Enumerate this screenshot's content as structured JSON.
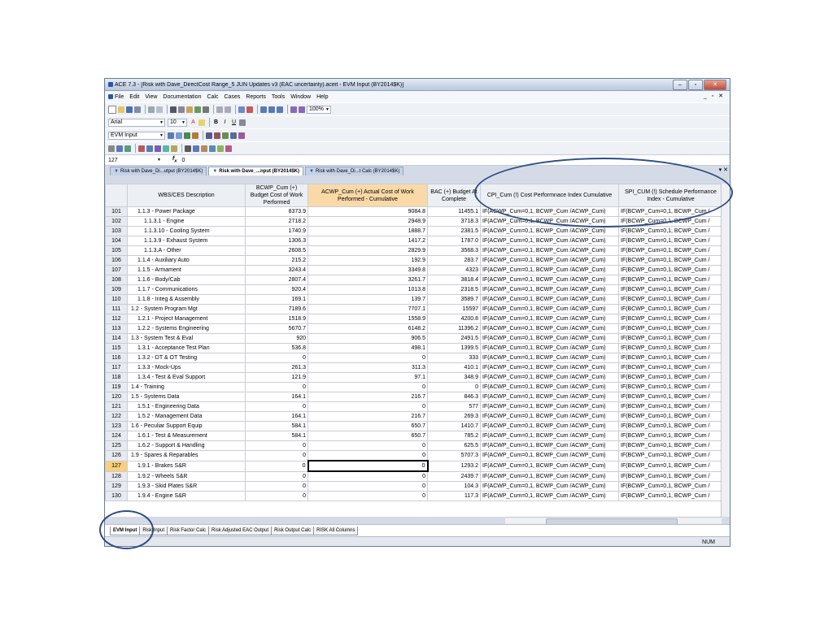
{
  "window": {
    "title": "ACE 7.3 - [Risk with Dave_DirectCost Range_5 JUN Updates v3 (EAC uncertainty).aceit - EVM Input (BY2014$K)]"
  },
  "menu": [
    "File",
    "Edit",
    "View",
    "Documentation",
    "Calc",
    "Cases",
    "Reports",
    "Tools",
    "Window",
    "Help"
  ],
  "toolbar": {
    "zoom": "100%"
  },
  "font": {
    "name": "Arial",
    "size": "10"
  },
  "view_combo": "EVM Input",
  "formula": {
    "cell": "127",
    "value": "0"
  },
  "doc_tabs": [
    "Risk with Dave_Di...utput (BY2014$K)",
    "Risk with Dave_...nput (BY2014$K)",
    "Risk with Dave_Di...t Calc (BY2014$K)"
  ],
  "columns": [
    "WBS/CES Description",
    "BCWP_Cum (+) Budget Cost of Work Performed",
    "ACWP_Cum (+) Actual Cost of Work Performed - Cumulative",
    "BAC (+) Budget At Complete",
    "CPI_Cum (!) Cost Performnace Index Cumulative",
    "SPI_CUM (!) Schedule Performance Index - Cumulative"
  ],
  "rows": [
    {
      "n": "101",
      "d": "1.1.3 - Power Package",
      "i": 1,
      "bcwp": "8373.9",
      "acwp": "9084.8",
      "bac": "11455.1"
    },
    {
      "n": "102",
      "d": "1.1.3.1 - Engine",
      "i": 2,
      "bcwp": "2718.2",
      "acwp": "2948.9",
      "bac": "3718.3"
    },
    {
      "n": "103",
      "d": "1.1.3.10 - Cooling System",
      "i": 2,
      "bcwp": "1740.9",
      "acwp": "1888.7",
      "bac": "2381.5"
    },
    {
      "n": "104",
      "d": "1.1.3.9 - Exhaust System",
      "i": 2,
      "bcwp": "1306.3",
      "acwp": "1417.2",
      "bac": "1787.0"
    },
    {
      "n": "105",
      "d": "1.1.3.A - Other",
      "i": 2,
      "bcwp": "2608.5",
      "acwp": "2829.9",
      "bac": "3568.3"
    },
    {
      "n": "106",
      "d": "1.1.4 - Auxiliary Auto",
      "i": 1,
      "bcwp": "215.2",
      "acwp": "192.9",
      "bac": "283.7"
    },
    {
      "n": "107",
      "d": "1.1.5 - Armament",
      "i": 1,
      "bcwp": "3243.4",
      "acwp": "3349.8",
      "bac": "4323"
    },
    {
      "n": "108",
      "d": "1.1.6 - Body/Cab",
      "i": 1,
      "bcwp": "2807.4",
      "acwp": "3261.7",
      "bac": "3818.4"
    },
    {
      "n": "109",
      "d": "1.1.7 - Communications",
      "i": 1,
      "bcwp": "920.4",
      "acwp": "1013.8",
      "bac": "2318.5"
    },
    {
      "n": "110",
      "d": "1.1.8 - Integ & Assembly",
      "i": 1,
      "bcwp": "169.1",
      "acwp": "139.7",
      "bac": "3589.7"
    },
    {
      "n": "111",
      "d": "1.2 - System Program Mgt",
      "i": 0,
      "bcwp": "7189.6",
      "acwp": "7707.1",
      "bac": "15597"
    },
    {
      "n": "112",
      "d": "1.2.1 - Project Management",
      "i": 1,
      "bcwp": "1518.9",
      "acwp": "1558.9",
      "bac": "4200.8"
    },
    {
      "n": "113",
      "d": "1.2.2 - Systems Engineering",
      "i": 1,
      "bcwp": "5670.7",
      "acwp": "6148.2",
      "bac": "11396.2"
    },
    {
      "n": "114",
      "d": "1.3 - System Test & Eval",
      "i": 0,
      "bcwp": "920",
      "acwp": "906.5",
      "bac": "2491.5"
    },
    {
      "n": "115",
      "d": "1.3.1 - Acceptance Test Plan",
      "i": 1,
      "bcwp": "536.8",
      "acwp": "498.1",
      "bac": "1399.5"
    },
    {
      "n": "116",
      "d": "1.3.2 - DT & OT Testing",
      "i": 1,
      "bcwp": "0",
      "acwp": "0",
      "bac": "333"
    },
    {
      "n": "117",
      "d": "1.3.3 - Mock-Ups",
      "i": 1,
      "bcwp": "261.3",
      "acwp": "311.3",
      "bac": "410.1"
    },
    {
      "n": "118",
      "d": "1.3.4 - Test & Eval Support",
      "i": 1,
      "bcwp": "121.9",
      "acwp": "97.1",
      "bac": "348.9"
    },
    {
      "n": "119",
      "d": "1.4 - Training",
      "i": 0,
      "bcwp": "0",
      "acwp": "0",
      "bac": "0"
    },
    {
      "n": "120",
      "d": "1.5 - Systems Data",
      "i": 0,
      "bcwp": "164.1",
      "acwp": "216.7",
      "bac": "846.3"
    },
    {
      "n": "121",
      "d": "1.5.1 - Engineering Data",
      "i": 1,
      "bcwp": "0",
      "acwp": "0",
      "bac": "577"
    },
    {
      "n": "122",
      "d": "1.5.2 - Management Data",
      "i": 1,
      "bcwp": "164.1",
      "acwp": "216.7",
      "bac": "269.3"
    },
    {
      "n": "123",
      "d": "1.6 - Peculiar Support Equip",
      "i": 0,
      "bcwp": "584.1",
      "acwp": "650.7",
      "bac": "1410.7"
    },
    {
      "n": "124",
      "d": "1.6.1 - Test & Measurement",
      "i": 1,
      "bcwp": "584.1",
      "acwp": "650.7",
      "bac": "785.2"
    },
    {
      "n": "125",
      "d": "1.6.2 - Support & Handling",
      "i": 1,
      "bcwp": "0",
      "acwp": "0",
      "bac": "625.5"
    },
    {
      "n": "126",
      "d": "1.9 - Spares & Reparables",
      "i": 0,
      "bcwp": "0",
      "acwp": "0",
      "bac": "5707.3"
    },
    {
      "n": "127",
      "d": "1.9.1 - Brakes S&R",
      "i": 1,
      "bcwp": "0",
      "acwp": "0",
      "bac": "1293.2"
    },
    {
      "n": "128",
      "d": "1.9.2 - Wheels S&R",
      "i": 1,
      "bcwp": "0",
      "acwp": "0",
      "bac": "2439.7"
    },
    {
      "n": "129",
      "d": "1.9.3 - Skid Plates S&R",
      "i": 1,
      "bcwp": "0",
      "acwp": "0",
      "bac": "104.3"
    },
    {
      "n": "130",
      "d": "1.9.4 - Engine S&R",
      "i": 1,
      "bcwp": "0",
      "acwp": "0",
      "bac": "117.3"
    }
  ],
  "cpi_formula": "IF(ACWP_Cum=0,1, BCWP_Cum /ACWP_Cum)",
  "spi_formula": "IF(BCWP_Cum=0,1, BCWP_Cum /",
  "selected_row": "127",
  "sheet_tabs": [
    "EVM Input",
    "Risk Input",
    "Risk Factor Calc",
    "Risk Adjusted EAC Output",
    "Risk Output Calc",
    "RISK All Columns"
  ],
  "status": {
    "num": "NUM"
  }
}
